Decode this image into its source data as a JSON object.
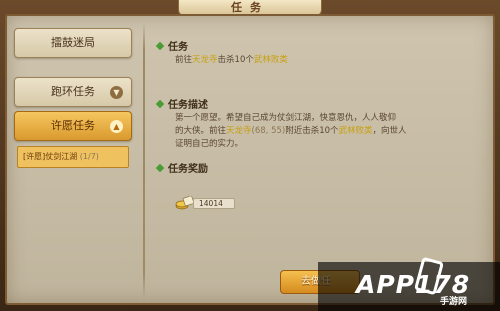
{
  "window": {
    "title": "任务"
  },
  "sidebar": {
    "items": [
      {
        "label": "擂鼓迷局",
        "chevron": false
      },
      {
        "label": "跑环任务",
        "chevron": true,
        "chevron_dir": "down"
      },
      {
        "label": "许愿任务",
        "chevron": true,
        "chevron_dir": "up",
        "active": true
      }
    ],
    "sub_item": {
      "prefix": "[许愿]",
      "label": "仗剑江湖",
      "progress": "(1/7)"
    }
  },
  "task": {
    "heading": "任务",
    "line_pre": "前往",
    "line_place": "天龙寺",
    "line_mid": "击杀10个",
    "line_target": "武林败类"
  },
  "desc": {
    "heading": "任务描述",
    "line1": "第一个愿望。希望自己成为仗剑江湖，快意恩仇，人人敬仰",
    "line2_pre": "的大侠。前往",
    "line2_place": "天龙寺",
    "line2_coord": "(68, 55)",
    "line2_mid": "附近击杀10个",
    "line2_target": "武林败类",
    "line2_post": "，向世人",
    "line3": "证明自己的实力。"
  },
  "reward": {
    "heading": "任务奖励",
    "icon": "coin-pile-icon",
    "value": "14014"
  },
  "actions": {
    "go_label": "去做任"
  },
  "watermark": {
    "brand": "APP178",
    "sub": "手游网"
  },
  "colors": {
    "accent_gold": "#c8a010",
    "active_tab": "#f0b040",
    "section_dot": "#4a9b35"
  }
}
